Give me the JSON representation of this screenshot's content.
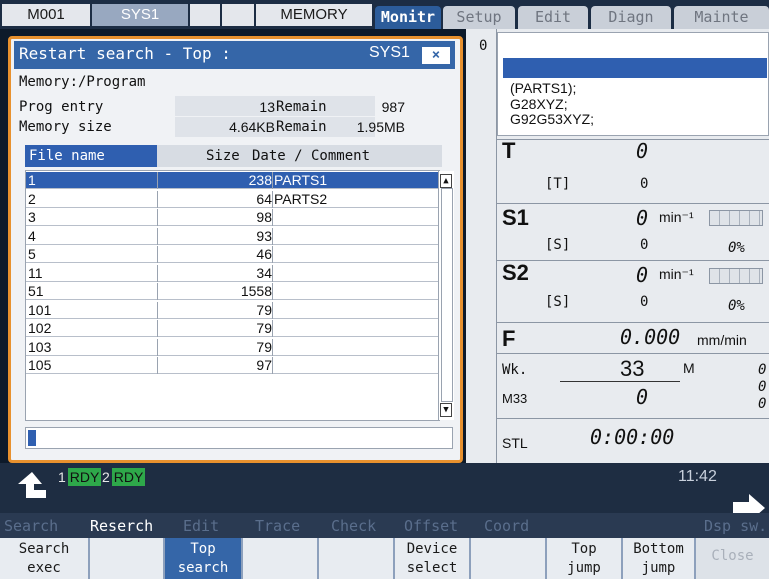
{
  "topbar": {
    "program": "M001",
    "system": "SYS1",
    "mode": "MEMORY",
    "tabs": [
      "Monitr",
      "Setup",
      "Edit",
      "Diagn",
      "Mainte"
    ]
  },
  "dialog": {
    "title": "Restart search - Top :",
    "system": "SYS1",
    "close": "×",
    "device": "Memory:/Program",
    "prog_entry_label": "Prog entry",
    "prog_entry_value": "13",
    "remain_label": "Remain",
    "remain_entries": "987",
    "memory_size_label": "Memory size",
    "memory_size_value": "4.64KB",
    "remain_label2": "Remain",
    "remain_size": "1.95MB",
    "columns": {
      "file_name": "File name",
      "size": "Size",
      "comment": "Date / Comment"
    },
    "files": [
      {
        "name": "1",
        "size": "238",
        "comment": "PARTS1"
      },
      {
        "name": "2",
        "size": "64",
        "comment": "PARTS2"
      },
      {
        "name": "3",
        "size": "98",
        "comment": ""
      },
      {
        "name": "4",
        "size": "93",
        "comment": ""
      },
      {
        "name": "5",
        "size": "46",
        "comment": ""
      },
      {
        "name": "11",
        "size": "34",
        "comment": ""
      },
      {
        "name": "51",
        "size": "1558",
        "comment": ""
      },
      {
        "name": "101",
        "size": "79",
        "comment": ""
      },
      {
        "name": "102",
        "size": "79",
        "comment": ""
      },
      {
        "name": "103",
        "size": "79",
        "comment": ""
      },
      {
        "name": "105",
        "size": "97",
        "comment": ""
      }
    ]
  },
  "monitor": {
    "line_no": "0",
    "program_lines": [
      "(PARTS1);",
      "G28XYZ;",
      "G92G53XYZ;"
    ],
    "t_label": "T",
    "t_value": "0",
    "t_sub_label": "[T]",
    "t_sub_value": "0",
    "s1_label": "S1",
    "s1_value": "0",
    "s1_unit": "min⁻¹",
    "s1_sub_label": "[S]",
    "s1_sub_value": "0",
    "s1_pct": "0%",
    "s2_label": "S2",
    "s2_value": "0",
    "s2_unit": "min⁻¹",
    "s2_sub_label": "[S]",
    "s2_sub_value": "0",
    "s2_pct": "0%",
    "f_label": "F",
    "f_value": "0.000",
    "f_unit": "mm/min",
    "wk_label": "Wk.",
    "wk_value": "33",
    "m_label": "M",
    "m33_label": "M33",
    "m33_value": "0",
    "m_right": [
      "0",
      "0",
      "0"
    ],
    "stl_label": "STL",
    "stl_value": "0:00:00"
  },
  "status": {
    "rdy1_num": "1",
    "rdy1": "RDY",
    "rdy2_num": "2",
    "rdy2": "RDY",
    "clock": "11:42"
  },
  "menu_labels": [
    "Search",
    "Reserch",
    "Edit",
    "Trace",
    "Check",
    "Offset",
    "Coord",
    "Dsp sw."
  ],
  "softkeys": {
    "search_exec": [
      "Search",
      "exec"
    ],
    "top_search": [
      "Top",
      "search"
    ],
    "device_select": [
      "Device",
      "select"
    ],
    "top_jump": [
      "Top",
      "jump"
    ],
    "bottom_jump": [
      "Bottom",
      "jump"
    ],
    "close": "Close"
  },
  "colors": {
    "accent": "#3566a8",
    "dialog_border": "#e8912e",
    "ready_green": "#2ea84a"
  }
}
